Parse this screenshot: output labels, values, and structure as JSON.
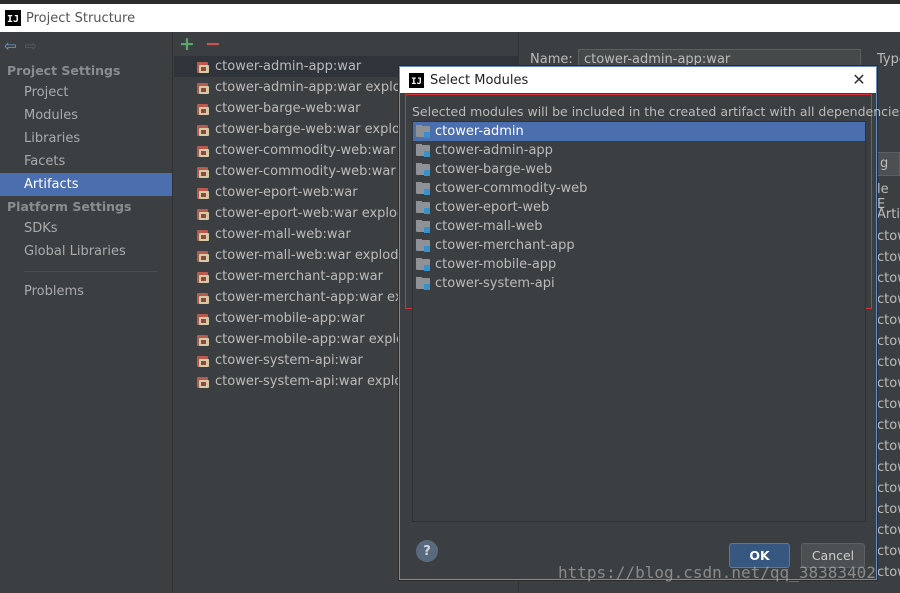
{
  "window": {
    "title": "Project Structure",
    "logo_text": "IJ"
  },
  "nav": {
    "back_icon": "arrow-left-icon",
    "forward_icon": "arrow-right-icon",
    "sections": [
      {
        "title": "Project Settings",
        "items": [
          "Project",
          "Modules",
          "Libraries",
          "Facets",
          "Artifacts"
        ]
      },
      {
        "title": "Platform Settings",
        "items": [
          "SDKs",
          "Global Libraries"
        ]
      }
    ],
    "extra_item": "Problems",
    "selected": "Artifacts"
  },
  "artifacts": {
    "add_symbol": "+",
    "remove_symbol": "−",
    "items": [
      "ctower-admin-app:war",
      "ctower-admin-app:war exploded",
      "ctower-barge-web:war",
      "ctower-barge-web:war exploded",
      "ctower-commodity-web:war",
      "ctower-commodity-web:war exploded",
      "ctower-eport-web:war",
      "ctower-eport-web:war exploded",
      "ctower-mall-web:war",
      "ctower-mall-web:war exploded",
      "ctower-merchant-app:war",
      "ctower-merchant-app:war exploded",
      "ctower-mobile-app:war",
      "ctower-mobile-app:war exploded",
      "ctower-system-api:war",
      "ctower-system-api:war exploded"
    ]
  },
  "detail": {
    "name_label": "Name:",
    "name_value": "ctower-admin-app:war",
    "type_label": "Type",
    "tab_stub": "g",
    "header_stub": "le E",
    "header_stub2": "Artif",
    "row_stub": "ctow"
  },
  "dialog": {
    "title": "Select Modules",
    "close_icon": "close-icon",
    "description": "Selected modules will be included in the created artifact with all dependencies",
    "modules": [
      "ctower-admin",
      "ctower-admin-app",
      "ctower-barge-web",
      "ctower-commodity-web",
      "ctower-eport-web",
      "ctower-mall-web",
      "ctower-merchant-app",
      "ctower-mobile-app",
      "ctower-system-api"
    ],
    "selected_module": "ctower-admin",
    "help_label": "?",
    "ok_label": "OK",
    "cancel_label": "Cancel"
  },
  "watermark": "https://blog.csdn.net/qq_38383402",
  "colors": {
    "selection": "#4b6eaf",
    "highlight_box": "#d9333a",
    "background": "#3c3f41"
  }
}
